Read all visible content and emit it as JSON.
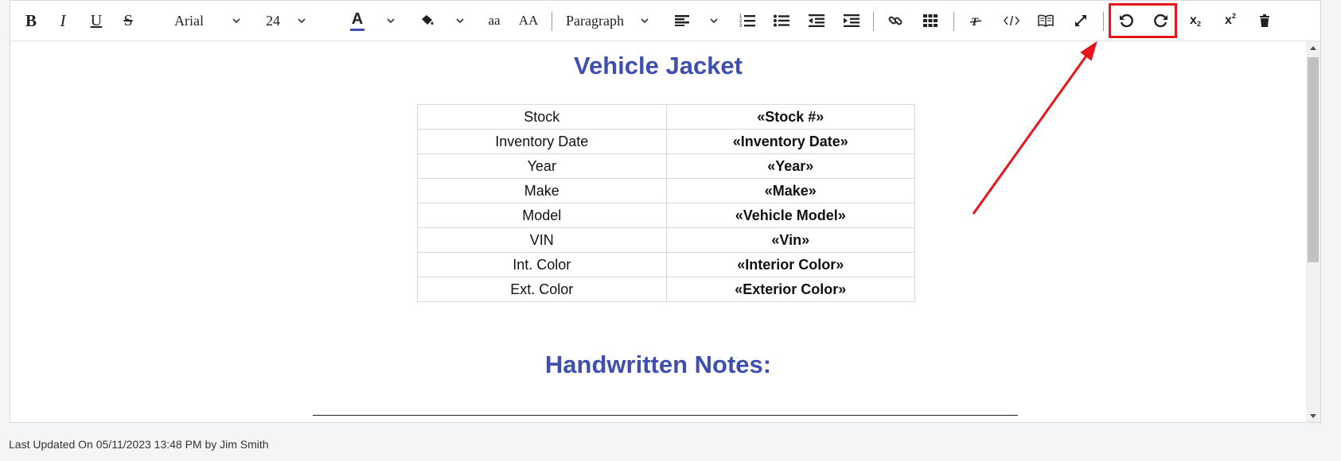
{
  "toolbar": {
    "bold": "B",
    "italic": "I",
    "underline": "U",
    "strikethrough": "S",
    "font_family": "Arial",
    "font_size": "24",
    "text_color_glyph": "A",
    "lowercase": "aa",
    "uppercase": "AA",
    "block_format": "Paragraph",
    "subscript": "x",
    "subscript_mark": "2",
    "superscript": "x",
    "superscript_mark": "2",
    "highlight_color": "#e8141b"
  },
  "document": {
    "title": "Vehicle Jacket",
    "rows": [
      {
        "label": "Stock",
        "value": "«Stock #»"
      },
      {
        "label": "Inventory Date",
        "value": "«Inventory Date»"
      },
      {
        "label": "Year",
        "value": "«Year»"
      },
      {
        "label": "Make",
        "value": "«Make»"
      },
      {
        "label": "Model",
        "value": "«Vehicle Model»"
      },
      {
        "label": "VIN",
        "value": "«Vin»"
      },
      {
        "label": "Int. Color",
        "value": "«Interior Color»"
      },
      {
        "label": "Ext. Color",
        "value": "«Exterior Color»"
      }
    ],
    "notes_title": "Handwritten Notes:",
    "heading_color": "#3f4fb0"
  },
  "status": {
    "last_updated": "Last Updated On 05/11/2023 13:48 PM by Jim Smith"
  }
}
